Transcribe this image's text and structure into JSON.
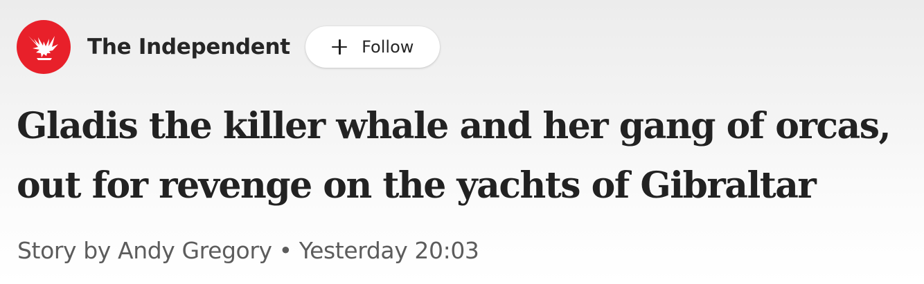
{
  "publisher": {
    "name": "The Independent",
    "logo_icon": "eagle-icon",
    "logo_color": "#e8202a",
    "follow_label": "Follow"
  },
  "article": {
    "headline": "Gladis the killer whale and her gang of orcas, out for revenge on the yachts of Gibraltar",
    "byline": "Story by Andy Gregory",
    "separator": "•",
    "timestamp": "Yesterday 20:03"
  }
}
